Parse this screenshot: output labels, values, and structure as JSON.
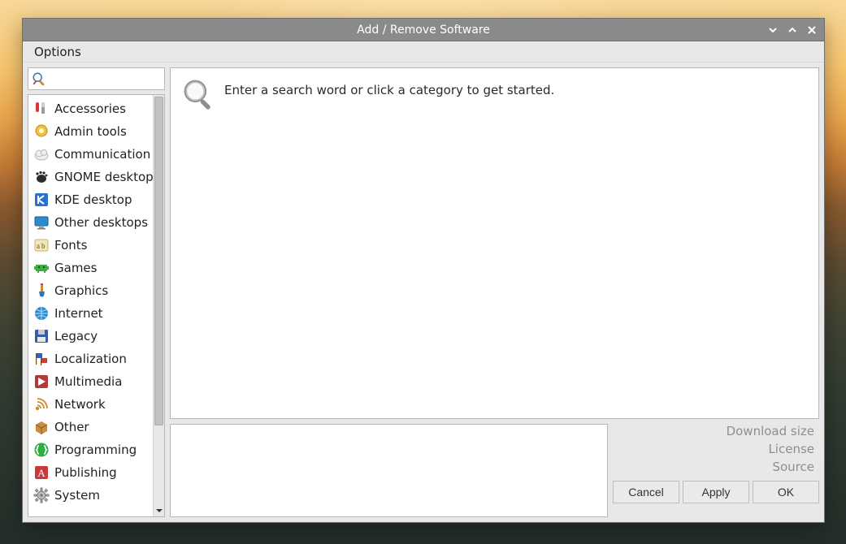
{
  "window": {
    "title": "Add / Remove Software"
  },
  "menubar": {
    "options": "Options"
  },
  "search": {
    "value": ""
  },
  "main": {
    "placeholder": "Enter a search word or click a category to get started."
  },
  "categories": [
    {
      "icon": "knife",
      "label": "Accessories"
    },
    {
      "icon": "badge",
      "label": "Admin tools"
    },
    {
      "icon": "cloud",
      "label": "Communication"
    },
    {
      "icon": "foot",
      "label": "GNOME desktop"
    },
    {
      "icon": "kde",
      "label": "KDE desktop"
    },
    {
      "icon": "desktop",
      "label": "Other desktops"
    },
    {
      "icon": "fonts",
      "label": "Fonts"
    },
    {
      "icon": "invader",
      "label": "Games"
    },
    {
      "icon": "brush",
      "label": "Graphics"
    },
    {
      "icon": "globe",
      "label": "Internet"
    },
    {
      "icon": "floppy",
      "label": "Legacy"
    },
    {
      "icon": "flags",
      "label": "Localization"
    },
    {
      "icon": "film",
      "label": "Multimedia"
    },
    {
      "icon": "network",
      "label": "Network"
    },
    {
      "icon": "box",
      "label": "Other"
    },
    {
      "icon": "braces",
      "label": "Programming"
    },
    {
      "icon": "letter-a",
      "label": "Publishing"
    },
    {
      "icon": "gear",
      "label": "System"
    }
  ],
  "meta": {
    "download_size": "Download size",
    "license": "License",
    "source": "Source"
  },
  "buttons": {
    "cancel": "Cancel",
    "apply": "Apply",
    "ok": "OK"
  }
}
